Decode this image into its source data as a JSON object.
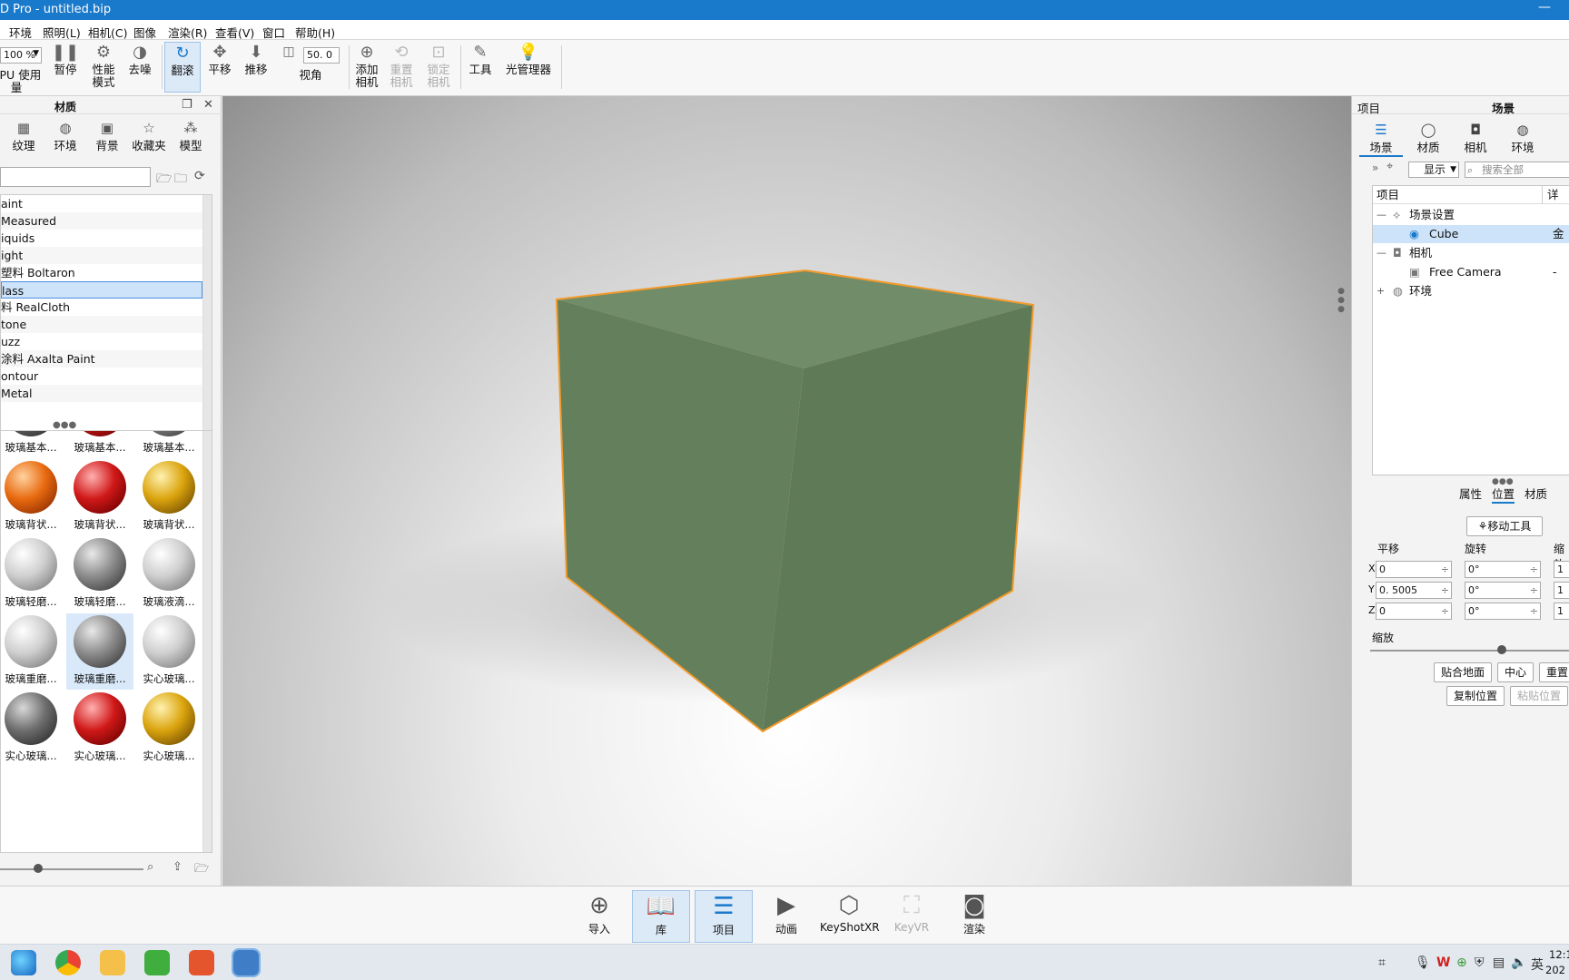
{
  "window": {
    "title": "D Pro  - untitled.bip",
    "minimize": "—"
  },
  "menu": [
    "环境",
    "照明(L)",
    "相机(C)",
    "图像",
    "渲染(R)",
    "查看(V)",
    "窗口",
    "帮助(H)"
  ],
  "toolbar": {
    "zoom_value": "100 %",
    "cpu_label": "CPU",
    "usage_label": "使用量",
    "pause_label": "暂停",
    "perf_label": "性能\n模式",
    "denoise_label": "去噪",
    "tumble_label": "翻滚",
    "pan_label": "平移",
    "dolly_label": "推移",
    "fov_value": "50. 0",
    "fov_label": "视角",
    "add_camera_label": "添加\n相机",
    "reset_camera_label": "重置\n相机",
    "lock_camera_label": "锁定\n相机",
    "tools_label": "工具",
    "light_manager_label": "光管理器"
  },
  "library": {
    "title": "材质",
    "tabs": [
      "纹理",
      "环境",
      "背景",
      "收藏夹",
      "模型"
    ],
    "categories": [
      "aint",
      "Measured",
      "iquids",
      "ight",
      "塑料 Boltaron",
      "lass",
      "料 RealCloth",
      "tone",
      "uzz",
      "涂料 Axalta Paint",
      "ontour",
      "Metal"
    ],
    "selected_category": 5,
    "thumbnails": [
      {
        "label": "玻璃基本...",
        "style": "g-dark"
      },
      {
        "label": "玻璃基本...",
        "style": "g-red"
      },
      {
        "label": "玻璃基本...",
        "style": "g-grey"
      },
      {
        "label": "玻璃背状...",
        "style": "g-orange"
      },
      {
        "label": "玻璃背状...",
        "style": "g-red"
      },
      {
        "label": "玻璃背状...",
        "style": "g-yellow"
      },
      {
        "label": "玻璃轻磨...",
        "style": "g-clear"
      },
      {
        "label": "玻璃轻磨...",
        "style": "g-grey"
      },
      {
        "label": "玻璃液滴...",
        "style": "g-clear"
      },
      {
        "label": "玻璃重磨...",
        "style": "g-clear"
      },
      {
        "label": "玻璃重磨...",
        "style": "g-grey"
      },
      {
        "label": "实心玻璃...",
        "style": "g-clear"
      },
      {
        "label": "实心玻璃...",
        "style": "g-dark"
      },
      {
        "label": "实心玻璃...",
        "style": "g-red"
      },
      {
        "label": "实心玻璃...",
        "style": "g-yellow"
      }
    ],
    "selected_thumbnail": 10
  },
  "project": {
    "title_left": "项目",
    "title_right": "场景",
    "tabs": [
      "场景",
      "材质",
      "相机",
      "环境"
    ],
    "display_dropdown": "显示",
    "search_placeholder": "搜索全部",
    "tree_header": "项目",
    "tree_header_right": "详",
    "tree": [
      {
        "label": "场景设置",
        "toggle": "—",
        "indent": 0
      },
      {
        "label": "Cube",
        "toggle": "",
        "indent": 1,
        "value": "金"
      },
      {
        "label": "相机",
        "toggle": "—",
        "indent": 0
      },
      {
        "label": "Free Camera",
        "toggle": "",
        "indent": 1,
        "value": "-"
      },
      {
        "label": "环境",
        "toggle": "+",
        "indent": 0
      }
    ],
    "subtabs": [
      "属性",
      "位置",
      "材质"
    ],
    "move_tool_label": "移动工具",
    "translate_label": "平移",
    "rotate_label": "旋转",
    "scale_col_label": "缩放",
    "axes": [
      "X",
      "Y",
      "Z"
    ],
    "translate": [
      "0",
      "0. 5005",
      "0"
    ],
    "rotate": [
      "0°",
      "0°",
      "0°"
    ],
    "scale": [
      "1",
      "1",
      "1"
    ],
    "scale_label": "缩放",
    "snap_ground": "贴合地面",
    "center": "中心",
    "reset": "重置",
    "copy_position": "复制位置",
    "paste_position": "粘贴位置"
  },
  "dock": [
    {
      "label": "导入",
      "icon": "import-icon",
      "on": false,
      "dis": false
    },
    {
      "label": "库",
      "icon": "library-icon",
      "on": true,
      "dis": false
    },
    {
      "label": "项目",
      "icon": "project-icon",
      "on": true,
      "dis": false
    },
    {
      "label": "动画",
      "icon": "animation-icon",
      "on": false,
      "dis": false
    },
    {
      "label": "KeyShotXR",
      "icon": "keyshotxr-icon",
      "on": false,
      "dis": false
    },
    {
      "label": "KeyVR",
      "icon": "keyvr-icon",
      "on": false,
      "dis": true
    },
    {
      "label": "渲染",
      "icon": "render-icon",
      "on": false,
      "dis": false
    }
  ],
  "taskbar": {
    "clock_time": "12:1",
    "clock_date": "202"
  },
  "colors": {
    "accent": "#1979ca",
    "cube": "#637f5c",
    "selection_outline": "#f39a2a"
  }
}
